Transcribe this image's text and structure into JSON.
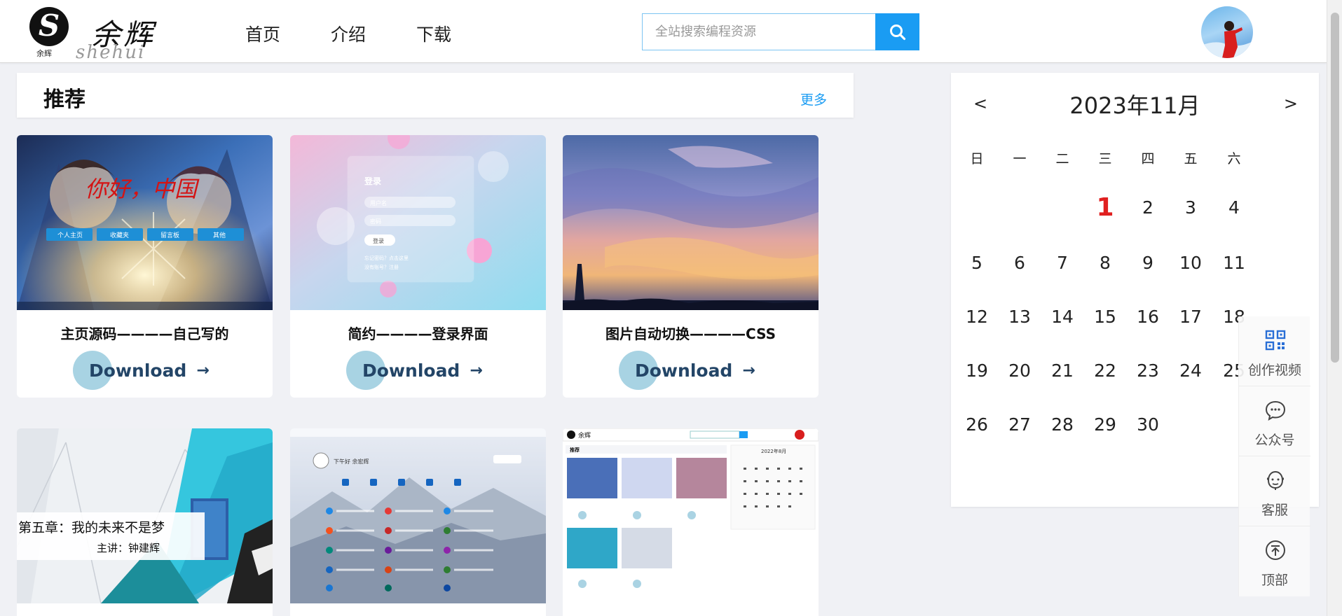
{
  "logo": {
    "mark_letter": "S",
    "mark_sub": "余辉",
    "script_main": "余辉",
    "script_sub": "shehui"
  },
  "nav": {
    "items": [
      "首页",
      "介绍",
      "下载"
    ]
  },
  "search": {
    "placeholder": "全站搜索编程资源",
    "value": ""
  },
  "icons": {
    "search": "search-icon",
    "avatar": "user-avatar"
  },
  "recommend": {
    "title": "推荐",
    "more": "更多"
  },
  "cards": [
    {
      "title": "主页源码————自己写的",
      "download": "Download",
      "arrow": "→"
    },
    {
      "title": "简约————登录界面",
      "download": "Download",
      "arrow": "→"
    },
    {
      "title": "图片自动切换————CSS",
      "download": "Download",
      "arrow": "→"
    },
    {
      "title": "",
      "download": "",
      "arrow": ""
    },
    {
      "title": "",
      "download": "",
      "arrow": ""
    },
    {
      "title": "",
      "download": "",
      "arrow": ""
    }
  ],
  "card1_overlay": {
    "text": "你好，中国",
    "buttons": [
      "个人主页",
      "收藏夹",
      "留言板",
      "其他"
    ]
  },
  "card2_overlay": {
    "login_title": "登录",
    "username": "用户名",
    "password": "密码",
    "btn": "登录",
    "forgot": "忘记密码？点击这里",
    "register": "没有账号？注册"
  },
  "card4_overlay": {
    "chapter": "第五章：我的未来不是梦",
    "speaker": "主讲：钟建辉"
  },
  "card5_overlay": {
    "greeting": "下午好 余宏辉"
  },
  "card6_overlay": {
    "logo": "余辉",
    "rec": "推荐",
    "month": "2022年8月"
  },
  "calendar": {
    "prev": "<",
    "next": ">",
    "title": "2023年11月",
    "weekdays": [
      "日",
      "一",
      "二",
      "三",
      "四",
      "五",
      "六"
    ],
    "days": [
      "1",
      "2",
      "3",
      "4",
      "5",
      "6",
      "7",
      "8",
      "9",
      "10",
      "11",
      "12",
      "13",
      "14",
      "15",
      "16",
      "17",
      "18",
      "19",
      "20",
      "21",
      "22",
      "23",
      "24",
      "25",
      "26",
      "27",
      "28",
      "29",
      "30"
    ],
    "today": "1",
    "first_weekday": 3
  },
  "side_tools": [
    {
      "label": "创作视频",
      "icon": "qrcode-icon"
    },
    {
      "label": "公众号",
      "icon": "wechat-icon"
    },
    {
      "label": "客服",
      "icon": "customer-service-icon"
    },
    {
      "label": "顶部",
      "icon": "back-to-top-icon"
    }
  ],
  "colors": {
    "accent": "#1a9cf3",
    "today": "#e02020",
    "download_text": "#234567",
    "download_circle": "#a8d3e3"
  }
}
